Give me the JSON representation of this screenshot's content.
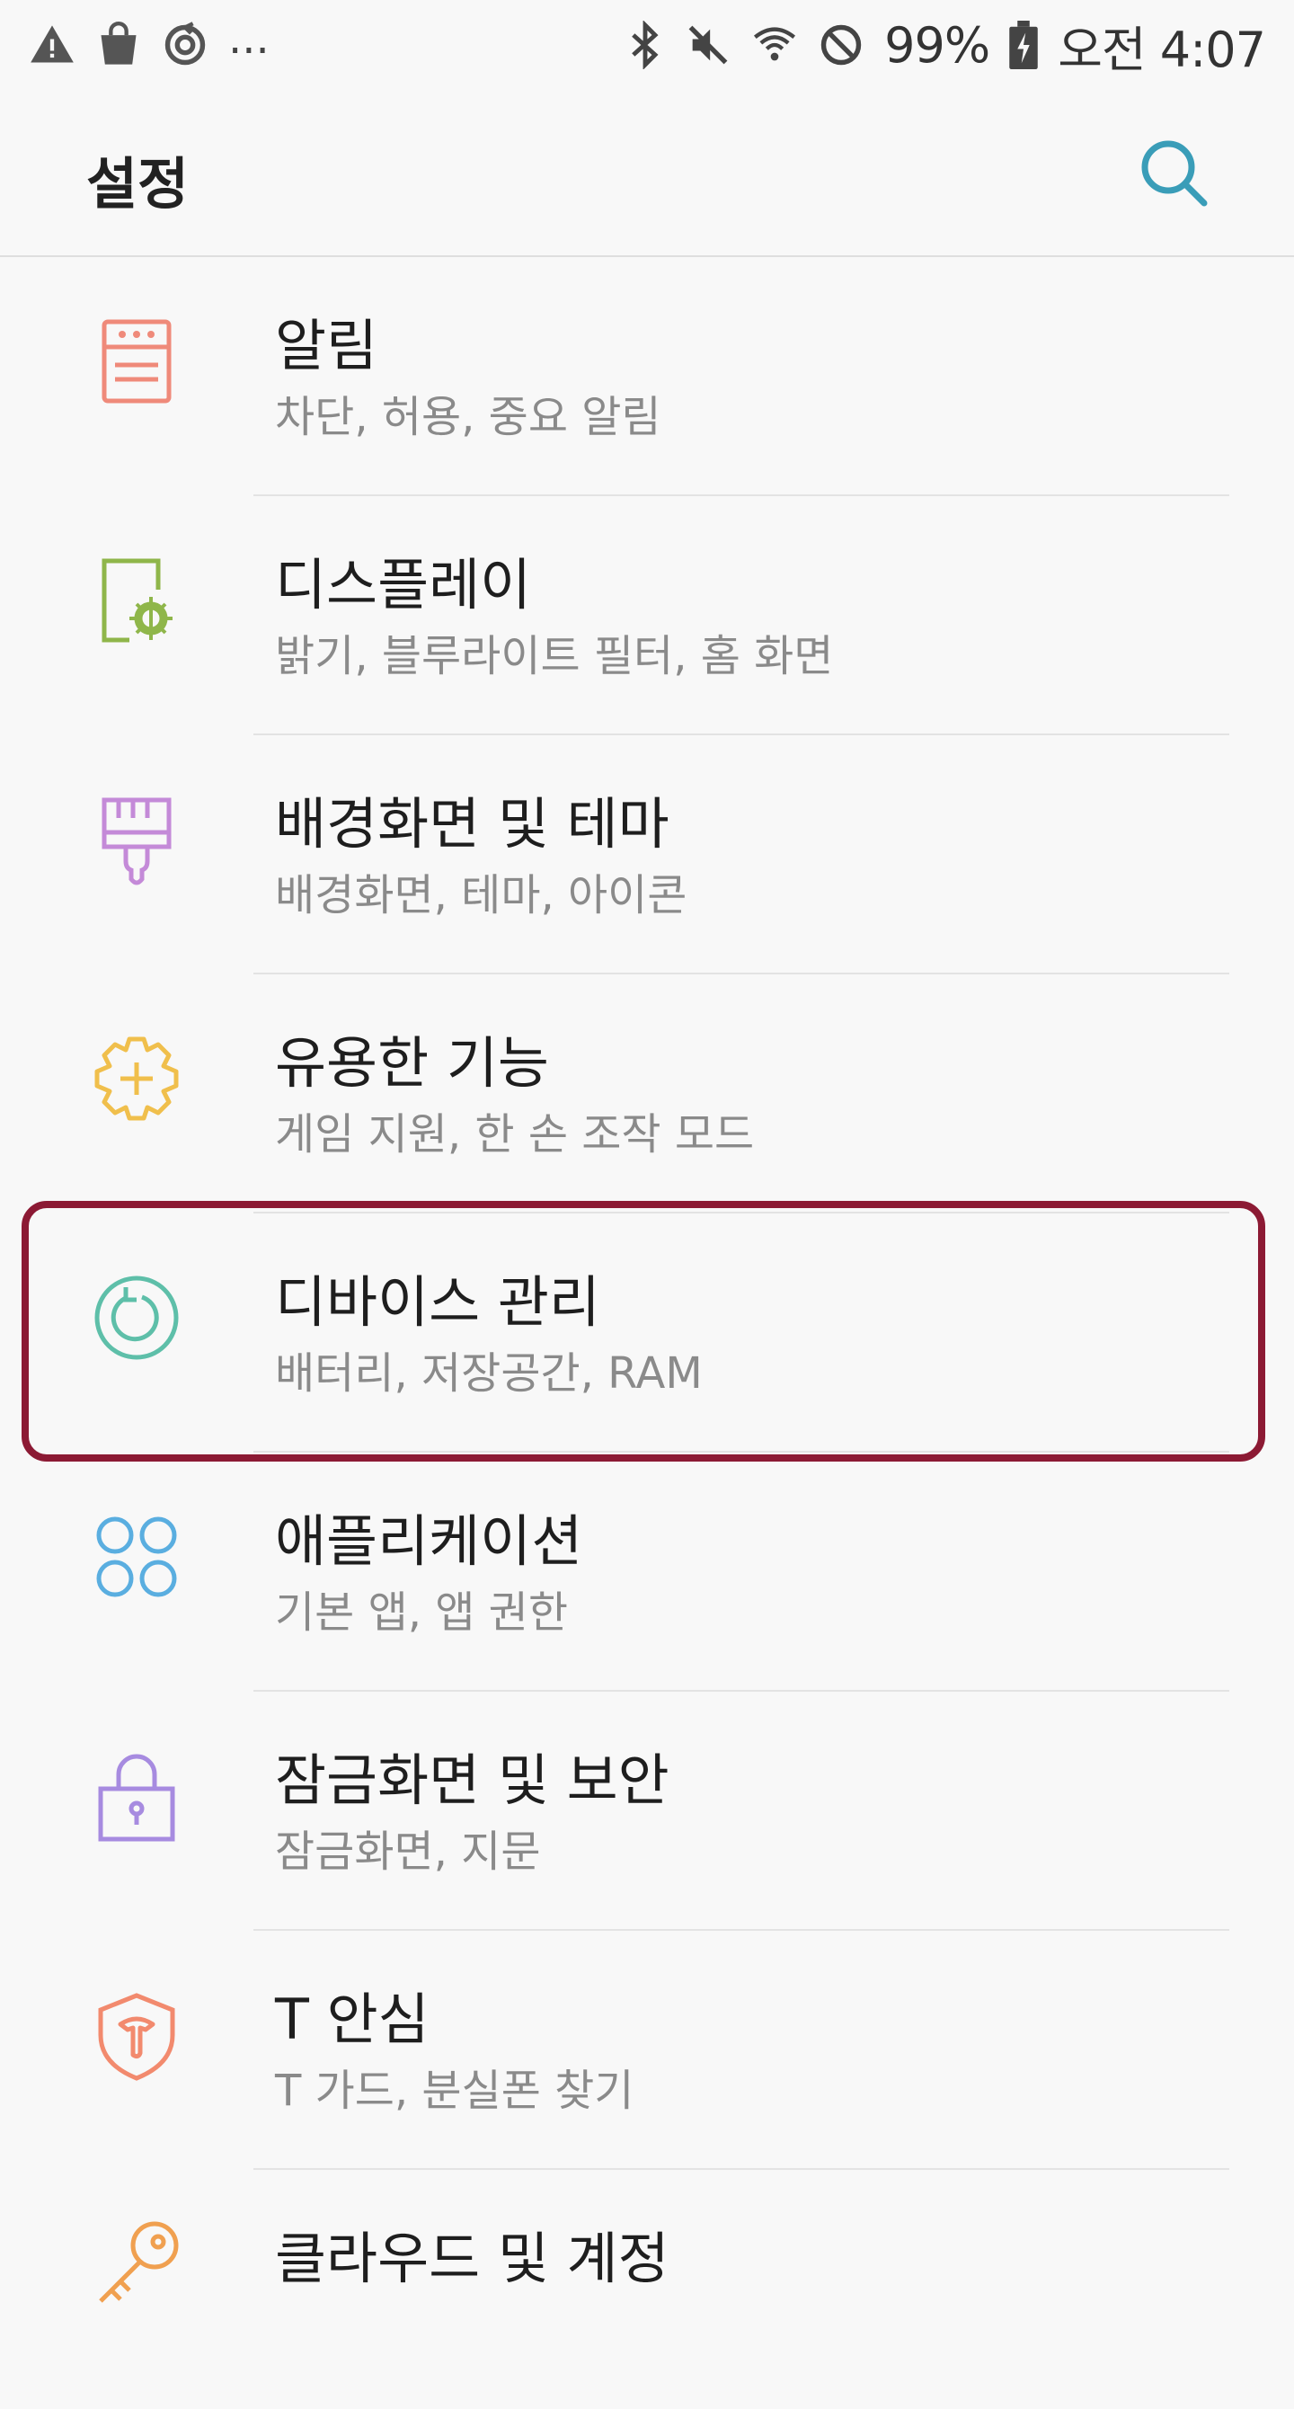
{
  "status_bar": {
    "battery": "99%",
    "time": "오전 4:07",
    "left_icons": [
      "warning-icon",
      "shopping-bag-icon",
      "sync-icon"
    ],
    "dots": "...",
    "right_icons": [
      "bluetooth-icon",
      "mute-icon",
      "wifi-icon",
      "block-icon",
      "battery-charging-icon"
    ]
  },
  "header": {
    "title": "설정",
    "search_icon": "search-icon",
    "accent": "#3a9db8"
  },
  "items": [
    {
      "title": "알림",
      "subtitle": "차단, 허용, 중요 알림",
      "icon": "notifications-icon",
      "color": "#ef8a7a"
    },
    {
      "title": "디스플레이",
      "subtitle": "밝기, 블루라이트 필터, 홈 화면",
      "icon": "display-icon",
      "color": "#8fb64a"
    },
    {
      "title": "배경화면 및 테마",
      "subtitle": "배경화면, 테마, 아이콘",
      "icon": "paintbrush-icon",
      "color": "#c48ad8"
    },
    {
      "title": "유용한 기능",
      "subtitle": "게임 지원, 한 손 조작 모드",
      "icon": "gear-plus-icon",
      "color": "#f0bf4c"
    },
    {
      "title": "디바이스 관리",
      "subtitle": "배터리, 저장공간, RAM",
      "icon": "device-care-icon",
      "color": "#5ebfa9"
    },
    {
      "title": "애플리케이션",
      "subtitle": "기본 앱, 앱 권한",
      "icon": "apps-icon",
      "color": "#5aaee0"
    },
    {
      "title": "잠금화면 및 보안",
      "subtitle": "잠금화면, 지문",
      "icon": "lock-icon",
      "color": "#a78be0"
    },
    {
      "title": "T 안심",
      "subtitle": "T 가드, 분실폰 찾기",
      "icon": "shield-icon",
      "color": "#f28a6e"
    },
    {
      "title": "클라우드 및 계정",
      "subtitle": "",
      "icon": "key-icon",
      "color": "#f0a050"
    }
  ],
  "highlight_color": "#8c1a34"
}
